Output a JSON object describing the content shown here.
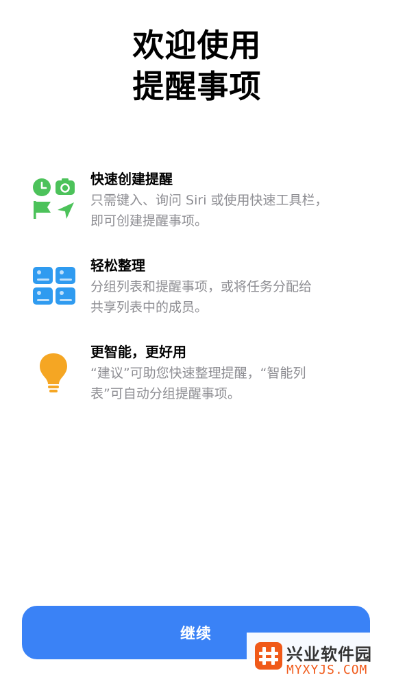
{
  "header": {
    "title_line1": "欢迎使用",
    "title_line2": "提醒事项"
  },
  "features": [
    {
      "icon": "reminder-types-icon",
      "title": "快速创建提醒",
      "desc_line1": "只需键入、询问 Siri 或使用快速工具栏，",
      "desc_line2": "即可创建提醒事项。"
    },
    {
      "icon": "lists-grid-icon",
      "title": "轻松整理",
      "desc_line1": "分组列表和提醒事项，或将任务分配给",
      "desc_line2": "共享列表中的成员。"
    },
    {
      "icon": "lightbulb-icon",
      "title": "更智能，更好用",
      "desc_line1": "“建议”可助您快速整理提醒，“智能列",
      "desc_line2": "表”可自动分组提醒事项。"
    }
  ],
  "footer": {
    "continue_label": "继续"
  },
  "watermark": {
    "name": "兴业软件园",
    "url": "MYXYJS.COM"
  },
  "colors": {
    "accent": "#3a82f6",
    "green": "#4cc25a",
    "blue": "#2f9bf0",
    "orange": "#f5a623",
    "secondary_text": "#8e8e93"
  }
}
